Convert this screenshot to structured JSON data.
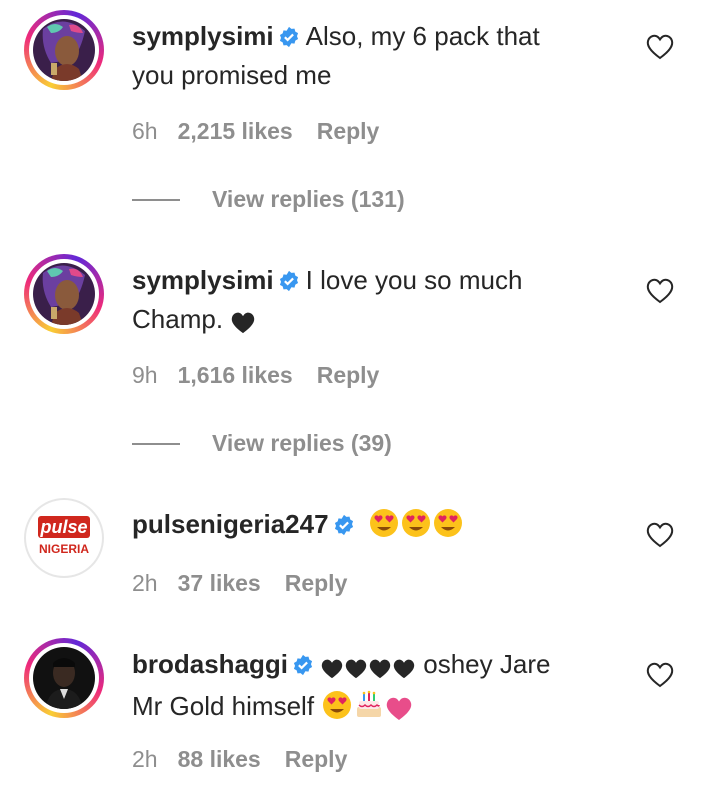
{
  "comments": [
    {
      "username": "symplysimi",
      "text_line1": "Also, my 6 pack that",
      "text_line2": "you promised me",
      "time": "6h",
      "likes": "2,215 likes",
      "reply": "Reply",
      "view_replies": "View replies (131)",
      "avatar_icon": "woman-portrait-avatar"
    },
    {
      "username": "symplysimi",
      "text_line1": "I love you so much",
      "text_line2": "Champ.",
      "time": "9h",
      "likes": "1,616 likes",
      "reply": "Reply",
      "view_replies": "View replies (39)",
      "avatar_icon": "woman-portrait-avatar"
    },
    {
      "username": "pulsenigeria247",
      "time": "2h",
      "likes": "37 likes",
      "reply": "Reply",
      "avatar_logo_top": "pulse",
      "avatar_logo_bottom": "NIGERIA",
      "emojis": [
        "heart-eyes-emoji",
        "heart-eyes-emoji",
        "heart-eyes-emoji"
      ]
    },
    {
      "username": "brodashaggi",
      "text_line1": "oshey Jare",
      "text_line2": "Mr Gold himself",
      "time": "2h",
      "likes": "88 likes",
      "reply": "Reply",
      "avatar_icon": "man-portrait-avatar"
    }
  ],
  "colors": {
    "text": "#262626",
    "muted": "#8e8e8e",
    "verified": "#3897f0",
    "pulse_red": "#d0271d"
  }
}
